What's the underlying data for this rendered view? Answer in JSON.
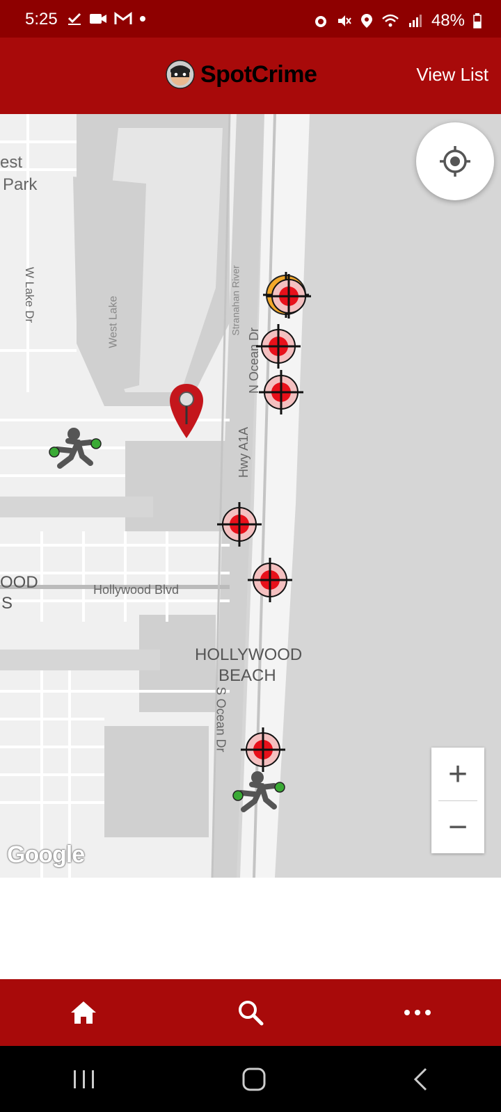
{
  "status_bar": {
    "time": "5:25",
    "battery": "48%"
  },
  "app_bar": {
    "logo_text": "SpotCrime",
    "view_list_label": "View List"
  },
  "map": {
    "labels": {
      "west_park_1": "est",
      "west_park_2": "Park",
      "w_lake_dr": "W Lake Dr",
      "west_lake": "West Lake",
      "stranahan": "Stranahan River",
      "n_ocean_dr": "N Ocean Dr",
      "hwy_a1a": "Hwy A1A",
      "hollywood_blvd": "Hollywood Blvd",
      "ood": "OOD",
      "s_letter": "S",
      "hollywood_beach_1": "HOLLYWOOD",
      "hollywood_beach_2": "BEACH",
      "s_ocean_dr": "S Ocean Dr"
    },
    "zoom_in_label": "+",
    "zoom_out_label": "−",
    "attribution": "Google"
  },
  "bottom_nav": {
    "home_icon": "home-icon",
    "search_icon": "search-icon",
    "more_icon": "more-icon"
  }
}
